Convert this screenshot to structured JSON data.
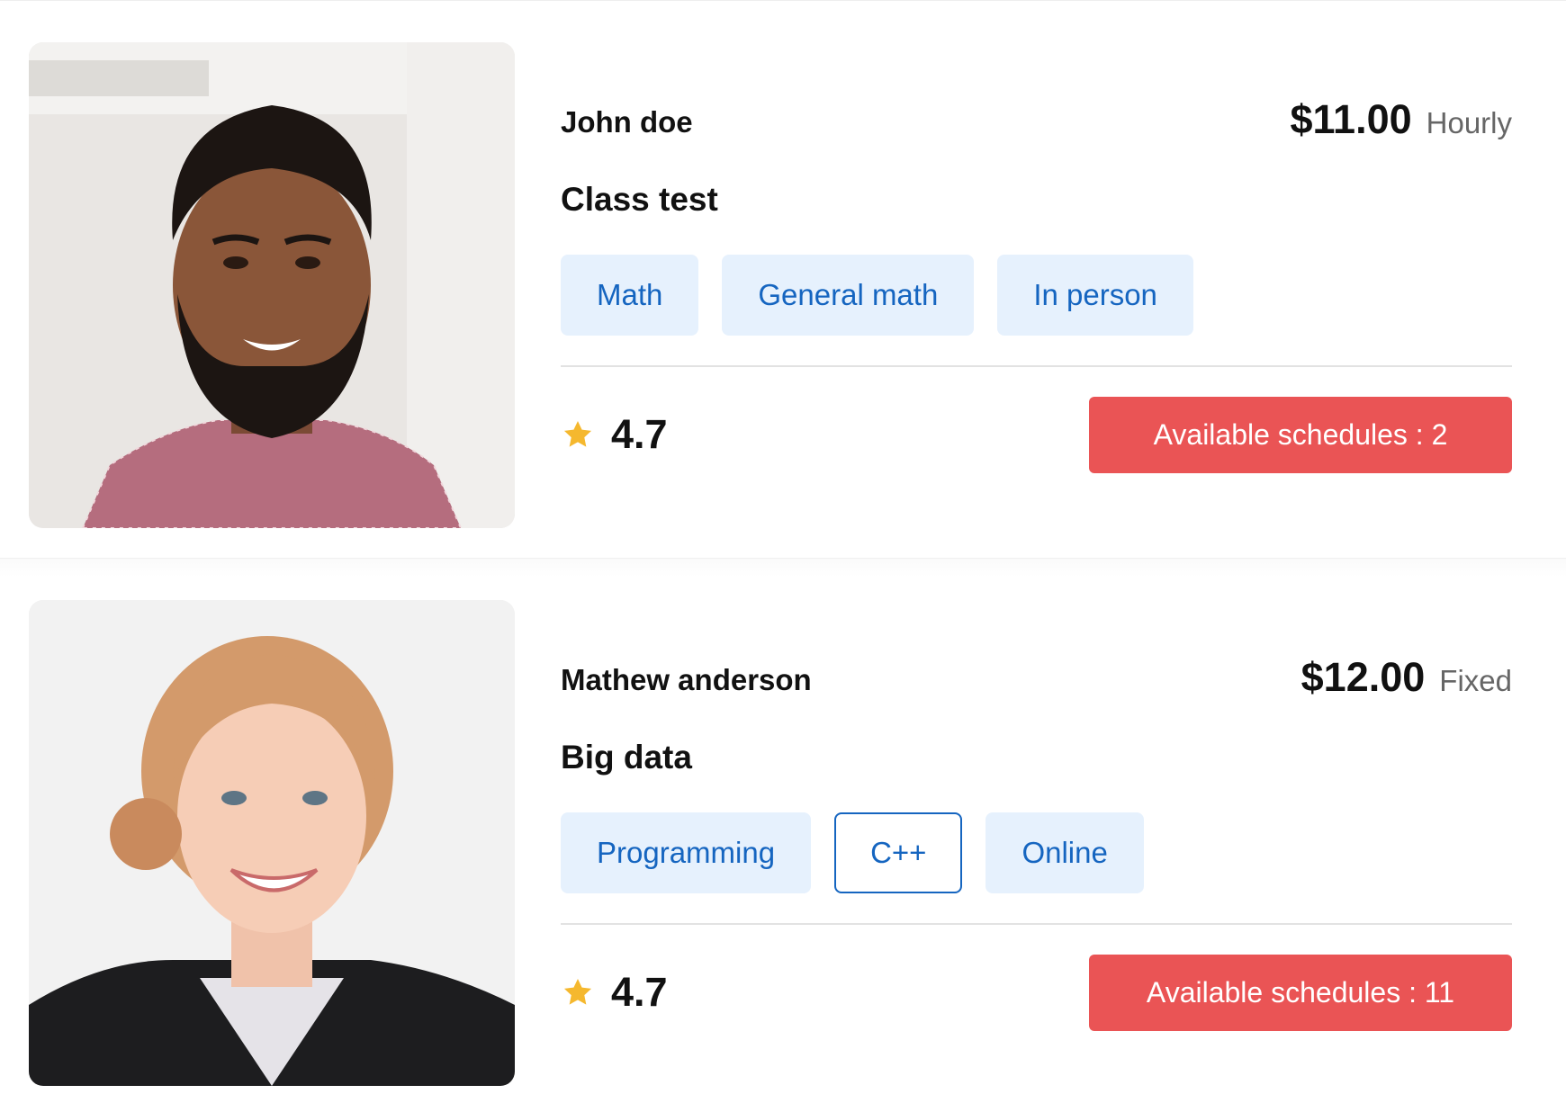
{
  "tutors": [
    {
      "name": "John doe",
      "price": "$11.00",
      "price_type": "Hourly",
      "course": "Class test",
      "tags": [
        "Math",
        "General math",
        "In person"
      ],
      "rating": "4.7",
      "schedule_button": "Available schedules : 2"
    },
    {
      "name": "Mathew anderson",
      "price": "$12.00",
      "price_type": "Fixed",
      "course": "Big data",
      "tags": [
        "Programming",
        "C++",
        "Online"
      ],
      "rating": "4.7",
      "schedule_button": "Available schedules : 11"
    }
  ],
  "colors": {
    "accent_button": "#ea5455",
    "tag_bg": "#e6f1fd",
    "tag_text": "#1565c0",
    "star": "#f5b82e"
  },
  "icons": {
    "rating": "star-icon"
  }
}
